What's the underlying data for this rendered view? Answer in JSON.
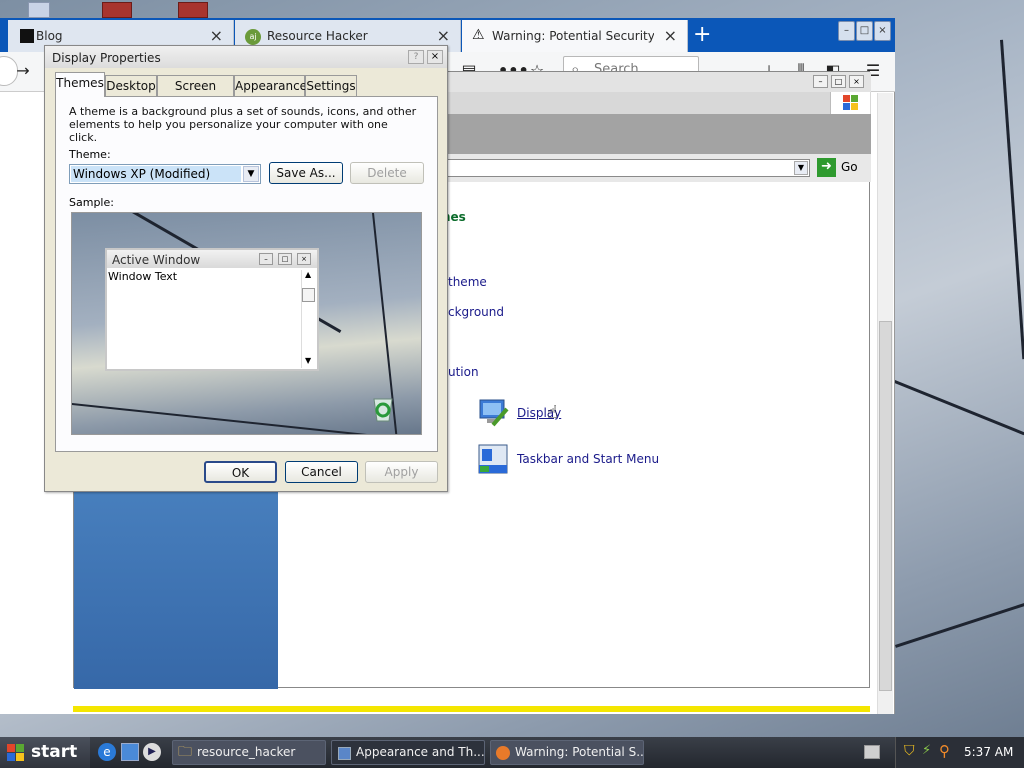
{
  "firefox": {
    "tabs": [
      {
        "label": "Blog",
        "icon": "blog-favicon-icon"
      },
      {
        "label": "Resource Hacker",
        "icon": "resource-hacker-favicon-icon"
      },
      {
        "label": "Warning: Potential Security Risk",
        "icon": "warning-icon"
      }
    ],
    "search_placeholder": "Search",
    "accent": "#0b57b8"
  },
  "control_panel": {
    "go_label": "Go",
    "partial_links": [
      "mes",
      "theme",
      "ckground",
      "ution"
    ],
    "items": [
      {
        "label": "Display",
        "icon": "display-icon"
      },
      {
        "label": "Taskbar and Start Menu",
        "icon": "taskbar-icon"
      }
    ]
  },
  "dialog": {
    "title": "Display Properties",
    "tabs": [
      "Themes",
      "Desktop",
      "Screen Saver",
      "Appearance",
      "Settings"
    ],
    "description": "A theme is a background plus a set of sounds, icons, and other elements to help you personalize your computer with one click.",
    "theme_label": "Theme:",
    "theme_value": "Windows XP (Modified)",
    "save_as_label": "Save As...",
    "delete_label": "Delete",
    "sample_label": "Sample:",
    "sample_window_title": "Active Window",
    "sample_window_text": "Window Text",
    "ok_label": "OK",
    "cancel_label": "Cancel",
    "apply_label": "Apply"
  },
  "taskbar": {
    "start_label": "start",
    "buttons": [
      {
        "label": "resource_hacker",
        "icon": "folder-icon"
      },
      {
        "label": "Appearance and Th...",
        "icon": "control-panel-icon"
      },
      {
        "label": "Warning: Potential S...",
        "icon": "firefox-icon"
      }
    ],
    "clock": "5:37 AM"
  }
}
